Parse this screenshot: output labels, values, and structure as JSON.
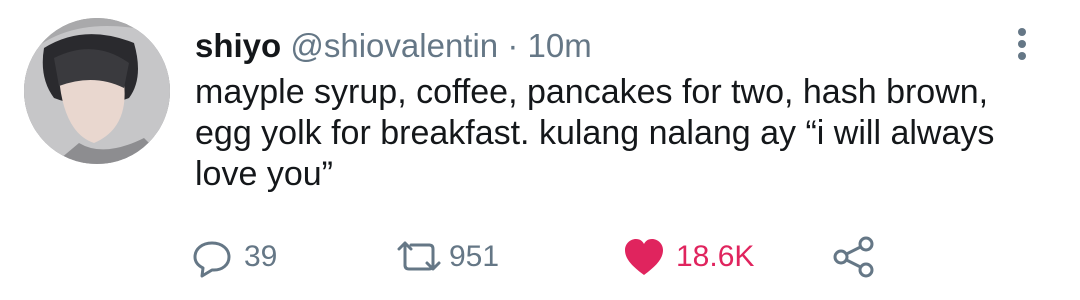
{
  "tweet": {
    "display_name": "shiyo",
    "handle": "@shiovalentin",
    "separator": "·",
    "time": "10m",
    "text": "mayple syrup, coffee, pancakes for two, hash brown, egg yolk for breakfast. kulang nalang ay “i will always love you”",
    "stats": {
      "replies": "39",
      "retweets": "951",
      "likes": "18.6K"
    },
    "liked": true
  },
  "icons": {
    "reply": "reply-icon",
    "retweet": "retweet-icon",
    "like": "heart-icon",
    "share": "share-icon",
    "more": "more-vertical-icon"
  },
  "colors": {
    "text": "#14171a",
    "secondary": "#657786",
    "like": "#e0245e"
  }
}
